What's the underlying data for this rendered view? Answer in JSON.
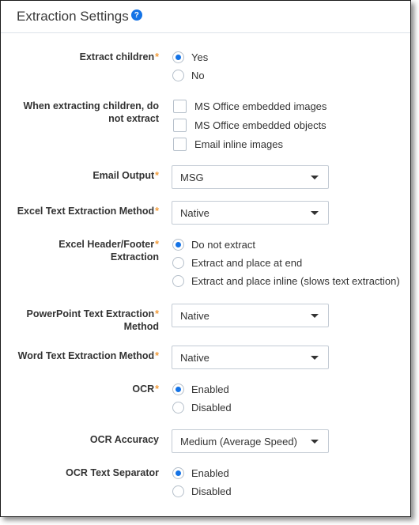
{
  "header": {
    "title": "Extraction Settings",
    "help_icon": "?"
  },
  "required_marker": "*",
  "colors": {
    "accent": "#1473e6",
    "required": "#f39c3a"
  },
  "fields": {
    "extract_children": {
      "label": "Extract children",
      "required": true,
      "options": [
        {
          "label": "Yes",
          "checked": true
        },
        {
          "label": "No",
          "checked": false
        }
      ]
    },
    "do_not_extract": {
      "label_line1": "When extracting children, do",
      "label_line2": "not extract",
      "options": [
        {
          "label": "MS Office embedded images",
          "checked": false
        },
        {
          "label": "MS Office embedded objects",
          "checked": false
        },
        {
          "label": "Email inline images",
          "checked": false
        }
      ]
    },
    "email_output": {
      "label": "Email Output",
      "required": true,
      "value": "MSG"
    },
    "excel_text_method": {
      "label": "Excel Text Extraction Method",
      "required": true,
      "value": "Native"
    },
    "excel_header_footer": {
      "label_line1": "Excel Header/Footer",
      "label_line2": "Extraction",
      "required": true,
      "options": [
        {
          "label": "Do not extract",
          "checked": true
        },
        {
          "label": "Extract and place at end",
          "checked": false
        },
        {
          "label": "Extract and place inline (slows text extraction)",
          "checked": false
        }
      ]
    },
    "powerpoint_method": {
      "label_line1": "PowerPoint Text Extraction",
      "label_line2": "Method",
      "required": true,
      "value": "Native"
    },
    "word_method": {
      "label": "Word Text Extraction Method",
      "required": true,
      "value": "Native"
    },
    "ocr": {
      "label": "OCR",
      "required": true,
      "options": [
        {
          "label": "Enabled",
          "checked": true
        },
        {
          "label": "Disabled",
          "checked": false
        }
      ]
    },
    "ocr_accuracy": {
      "label": "OCR Accuracy",
      "value": "Medium (Average Speed)"
    },
    "ocr_text_separator": {
      "label": "OCR Text Separator",
      "options": [
        {
          "label": "Enabled",
          "checked": true
        },
        {
          "label": "Disabled",
          "checked": false
        }
      ]
    }
  }
}
